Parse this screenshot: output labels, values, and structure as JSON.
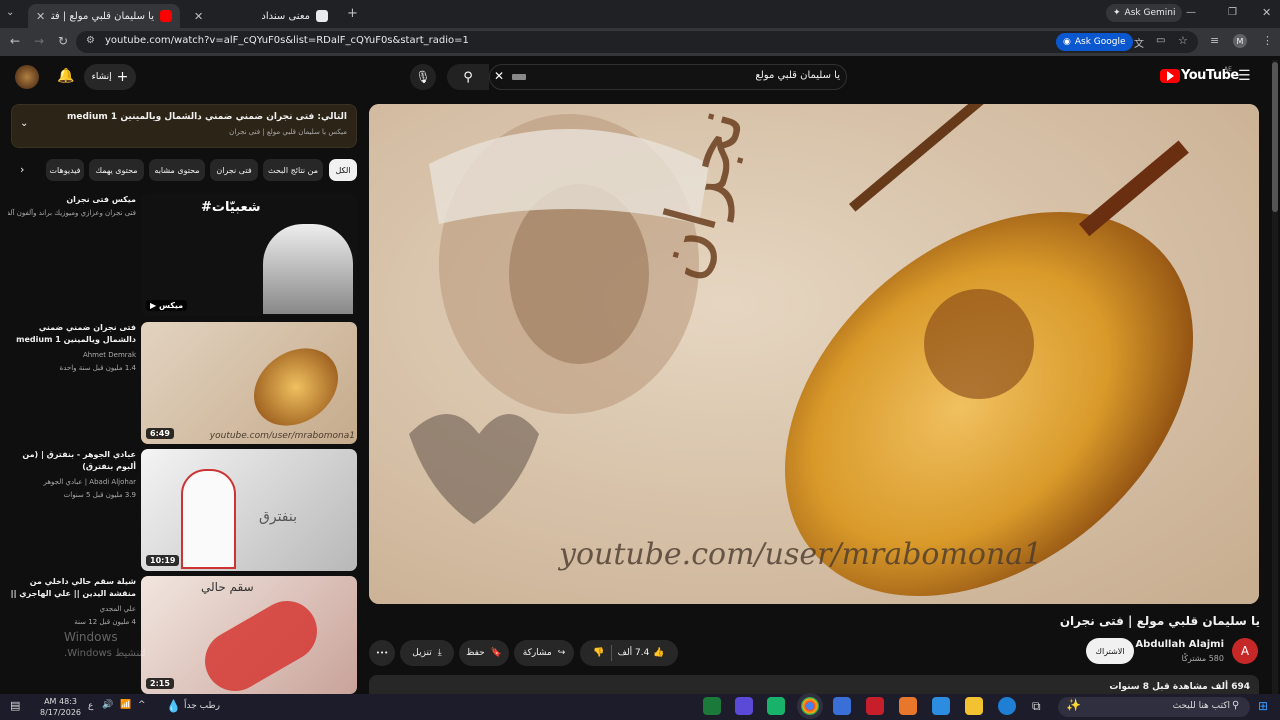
{
  "browser": {
    "tabs": [
      {
        "title": "يا سليمان قلبي مولع | فتى نجران",
        "active": true
      },
      {
        "title": "معنى سنداد",
        "active": false
      }
    ],
    "new_tab": "+",
    "ask_gemini": "Ask Gemini",
    "url": "youtube.com/watch?v=alF_cQYuF0s&list=RDalF_cQYuF0s&start_radio=1",
    "ask_google": "Ask Google",
    "profile_initial": "M"
  },
  "yt_header": {
    "logo": "YouTube",
    "region": "AE",
    "search_value": "يا سليمان قلبي مولع",
    "create_label": "إنشاء"
  },
  "video": {
    "title": "يا سليمان قلبي مولع | فتى نجران",
    "channel": "Abdullah Alajmi",
    "channel_initial": "A",
    "subscribers": "580 مشتركًا",
    "subscribe": "الاشتراك",
    "likes": "7.4 ألف",
    "share": "مشاركة",
    "save": "حفظ",
    "download": "تنزيل",
    "more": "•••",
    "views_line": "694 ألف مشاهدة  قبل 8 سنوات",
    "player_watermark": "youtube.com/user/mrabomona1"
  },
  "up_next": {
    "title": "التالي: فتى نجران ضمني ضمني دالشمال ويالمينين 1 medium",
    "subtitle": "ميكس يا سليمان قلبي مولع | فتى نجران"
  },
  "filter_chips": [
    "الكل",
    "من نتائج البحث",
    "فتى نجران",
    "محتوى مشابه",
    "محتوى يهمك",
    "فيديوهات"
  ],
  "related": [
    {
      "title": "ميكس فتى نجران",
      "meta1": "فتى نجران وعزازي وميوزيك براند وآلفون آلف...",
      "meta2": "",
      "badge": "ميكس",
      "thumb_text": "#شعبيّات"
    },
    {
      "title": "فتى نجران   ضمني ضمني دالشمال ويالمينين   1  medium",
      "meta1": "Ahmet Demrak",
      "meta2": "1.4 مليون  قبل سنة واحدة",
      "badge": "6:49",
      "thumb_text": ""
    },
    {
      "title": "عبادي الجوهر - بنفترق | (من ألبوم بنفترق)",
      "meta1": "Abadi Aljohar | عبادي الجوهر",
      "meta2": "3.9 مليون  قبل 5 سنوات",
      "badge": "10:19",
      "thumb_text": "بنفترق"
    },
    {
      "title": "شيلة سقم حالي داخلي من منقشة اليدين || علي الهاجري ||",
      "meta1": "علي المجدي",
      "meta2": "4 مليون  قبل 12 سنة",
      "badge": "2:15",
      "thumb_text": "سقم حالي"
    }
  ],
  "windows_watermark": {
    "line1": "Windows",
    "line2": "لتنشيط Windows."
  },
  "taskbar": {
    "search_placeholder": "اكتب هنا للبحث",
    "weather": "رطب جداً",
    "time": "AM 48:3",
    "date": "8/17/2026",
    "lang": "ع"
  },
  "colors": {
    "yt_red": "#ff0000",
    "bg": "#0f0f0f",
    "chip": "#272727"
  }
}
